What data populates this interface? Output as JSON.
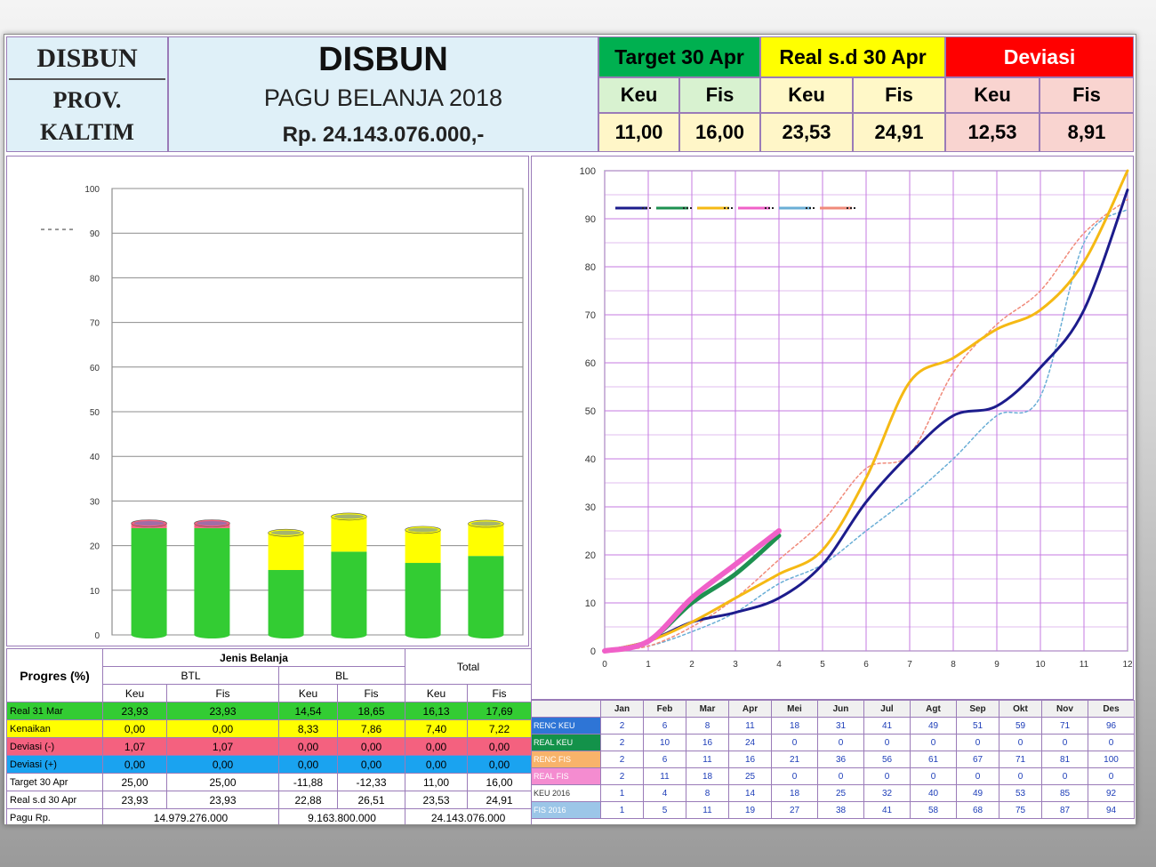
{
  "header": {
    "left_line1": "DISBUN",
    "left_line2": "PROV.",
    "left_line3": "KALTIM",
    "title": "DISBUN",
    "subtitle": "PAGU BELANJA 2018",
    "amount": "Rp. 24.143.076.000,-",
    "groups": [
      {
        "label": "Target 30 Apr",
        "bg": "#00b050",
        "fg": "#000000",
        "sub_bg": "#d8f2d0",
        "keu_label": "Keu",
        "fis_label": "Fis",
        "keu": "11,00",
        "fis": "16,00"
      },
      {
        "label": "Real s.d 30 Apr",
        "bg": "#ffff00",
        "fg": "#000000",
        "sub_bg": "#fff8c8",
        "keu_label": "Keu",
        "fis_label": "Fis",
        "keu": "23,53",
        "fis": "24,91"
      },
      {
        "label": "Deviasi",
        "bg": "#ff0000",
        "fg": "#ffffff",
        "sub_bg": "#f9d4d0",
        "keu_label": "Keu",
        "fis_label": "Fis",
        "keu": "12,53",
        "fis": "8,91"
      }
    ]
  },
  "left_table": {
    "group_header": "Jenis Belanja",
    "corner_label": "Progres (%)",
    "total_label": "Total",
    "sub_groups": [
      "BTL",
      "BL"
    ],
    "cols": [
      "Keu",
      "Fis",
      "Keu",
      "Fis",
      "Keu",
      "Fis"
    ],
    "rows": [
      {
        "label": "Real 31 Mar",
        "color": "#33cc33",
        "values": [
          "23,93",
          "23,93",
          "14,54",
          "18,65",
          "16,13",
          "17,69"
        ]
      },
      {
        "label": "Kenaikan",
        "color": "#ffff00",
        "values": [
          "0,00",
          "0,00",
          "8,33",
          "7,86",
          "7,40",
          "7,22"
        ]
      },
      {
        "label": "Deviasi  (-)",
        "color": "#f4617f",
        "values": [
          "1,07",
          "1,07",
          "0,00",
          "0,00",
          "0,00",
          "0,00"
        ]
      },
      {
        "label": "Deviasi (+)",
        "color": "#1aa3f0",
        "values": [
          "0,00",
          "0,00",
          "0,00",
          "0,00",
          "0,00",
          "0,00"
        ]
      },
      {
        "label": "Target 30 Apr",
        "color": "#ffffff",
        "values": [
          "25,00",
          "25,00",
          "-11,88",
          "-12,33",
          "11,00",
          "16,00"
        ]
      },
      {
        "label": "Real s.d 30 Apr",
        "color": "#ffffff",
        "values": [
          "23,93",
          "23,93",
          "22,88",
          "26,51",
          "23,53",
          "24,91"
        ]
      }
    ],
    "pagu_label": "Pagu Rp.",
    "pagu_values": [
      "14.979.276.000",
      "9.163.800.000",
      "24.143.076.000"
    ]
  },
  "right_table": {
    "months": [
      "Jan",
      "Feb",
      "Mar",
      "Apr",
      "Mei",
      "Jun",
      "Jul",
      "Agt",
      "Sep",
      "Okt",
      "Nov",
      "Des"
    ],
    "rows": [
      {
        "label": "RENC KEU",
        "bg": "#2e75d6",
        "values": [
          "2",
          "6",
          "8",
          "11",
          "18",
          "31",
          "41",
          "49",
          "51",
          "59",
          "71",
          "96"
        ]
      },
      {
        "label": "REAL KEU",
        "bg": "#13924a",
        "values": [
          "2",
          "10",
          "16",
          "24",
          "0",
          "0",
          "0",
          "0",
          "0",
          "0",
          "0",
          "0"
        ]
      },
      {
        "label": "RENC FIS",
        "bg": "#f8b36a",
        "values": [
          "2",
          "6",
          "11",
          "16",
          "21",
          "36",
          "56",
          "61",
          "67",
          "71",
          "81",
          "100"
        ]
      },
      {
        "label": "REAL FIS",
        "bg": "#f48cd0",
        "values": [
          "2",
          "11",
          "18",
          "25",
          "0",
          "0",
          "0",
          "0",
          "0",
          "0",
          "0",
          "0"
        ]
      },
      {
        "label": "KEU 2016",
        "bg": "#ffffff",
        "values": [
          "1",
          "4",
          "8",
          "14",
          "18",
          "25",
          "32",
          "40",
          "49",
          "53",
          "85",
          "92"
        ]
      },
      {
        "label": "FIS 2016",
        "bg": "#9cc6e8",
        "values": [
          "1",
          "5",
          "11",
          "19",
          "27",
          "38",
          "41",
          "58",
          "68",
          "75",
          "87",
          "94"
        ]
      }
    ]
  },
  "chart_data": [
    {
      "type": "bar",
      "stacked": true,
      "categories": [
        "BTL Keu",
        "BTL Fis",
        "BL Keu",
        "BL Fis",
        "Total Keu",
        "Total Fis"
      ],
      "series": [
        {
          "name": "Real 31 Mar",
          "color": "#33cc33",
          "values": [
            23.93,
            23.93,
            14.54,
            18.65,
            16.13,
            17.69
          ]
        },
        {
          "name": "Kenaikan",
          "color": "#ffff00",
          "values": [
            0,
            0,
            8.33,
            7.86,
            7.4,
            7.22
          ]
        },
        {
          "name": "Deviasi  (-)",
          "color": "#f4617f",
          "values": [
            1.07,
            1.07,
            0,
            0,
            0,
            0
          ]
        },
        {
          "name": "Deviasi (+)",
          "color": "#1aa3f0",
          "values": [
            0,
            0,
            0,
            0,
            0,
            0
          ]
        }
      ],
      "ylim": [
        0,
        100
      ],
      "yticks": [
        0,
        10,
        20,
        30,
        40,
        50,
        60,
        70,
        80,
        90,
        100
      ],
      "grid": true
    },
    {
      "type": "line",
      "x": [
        0,
        1,
        2,
        3,
        4,
        5,
        6,
        7,
        8,
        9,
        10,
        11,
        12
      ],
      "xlim": [
        0,
        12
      ],
      "ylim": [
        0,
        100
      ],
      "xticks": [
        0,
        1,
        2,
        3,
        4,
        5,
        6,
        7,
        8,
        9,
        10,
        11,
        12
      ],
      "yticks": [
        0,
        10,
        20,
        30,
        40,
        50,
        60,
        70,
        80,
        90,
        100
      ],
      "grid": true,
      "series": [
        {
          "name": "RENC KEU",
          "color": "#1c1c8c",
          "width": 3,
          "dash": "",
          "values": [
            0,
            2,
            6,
            8,
            11,
            18,
            31,
            41,
            49,
            51,
            59,
            71,
            96
          ]
        },
        {
          "name": "REAL KEU",
          "color": "#1e9150",
          "width": 5,
          "dash": "",
          "values": [
            0,
            2,
            10,
            16,
            24
          ]
        },
        {
          "name": "RENC FIS",
          "color": "#f5b914",
          "width": 3,
          "dash": "",
          "values": [
            0,
            2,
            6,
            11,
            16,
            21,
            36,
            56,
            61,
            67,
            71,
            81,
            100
          ]
        },
        {
          "name": "REAL FIS",
          "color": "#f060c8",
          "width": 6,
          "dash": "",
          "values": [
            0,
            2,
            11,
            18,
            25
          ]
        },
        {
          "name": "KEU 2016",
          "color": "#6aaed6",
          "width": 1.5,
          "dash": "3,3",
          "values": [
            0,
            1,
            4,
            8,
            14,
            18,
            25,
            32,
            40,
            49,
            53,
            85,
            92
          ]
        },
        {
          "name": "FIS 2016",
          "color": "#f08a7a",
          "width": 1.5,
          "dash": "3,3",
          "values": [
            0,
            1,
            5,
            11,
            19,
            27,
            38,
            41,
            58,
            68,
            75,
            87,
            94
          ]
        }
      ]
    }
  ]
}
